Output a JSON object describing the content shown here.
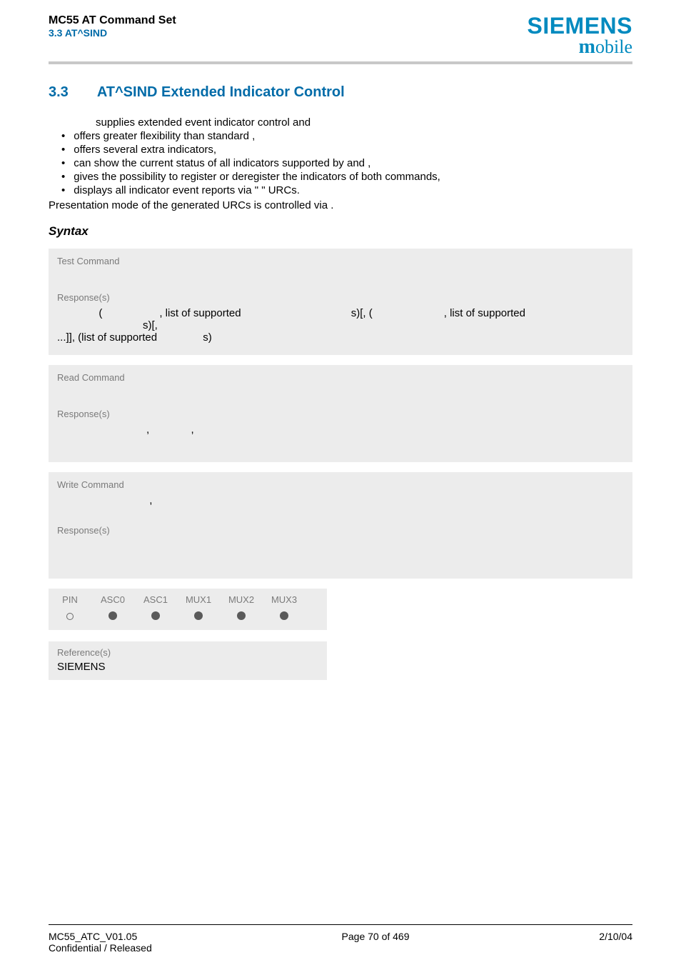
{
  "header": {
    "product": "MC55 AT Command Set",
    "section_ref": "3.3 AT^SIND",
    "brand_top": "SIEMENS",
    "brand_bottom_bold": "m",
    "brand_bottom_rest": "obile"
  },
  "section": {
    "number": "3.3",
    "title": "AT^SIND   Extended Indicator Control"
  },
  "intro": "supplies extended event indicator control and",
  "bullets": [
    "offers greater flexibility than standard               ,",
    "offers several extra indicators,",
    "can show the current status of all indicators supported by                  and               ,",
    "gives the possibility to register or deregister the indicators of both commands,",
    "displays all indicator event reports via \"            \" URCs."
  ],
  "presentation_line": "Presentation mode of the generated URCs is controlled via             .",
  "syntax_label": "Syntax",
  "panels": {
    "test": {
      "label": "Test Command",
      "body_spacer": " "
    },
    "test_resp": {
      "label": "Response(s)",
      "line1_parts": {
        "p1": "              (",
        "p2": ", list of supported ",
        "p3": "s)[, (",
        "p4": ", list of supported ",
        "p5": "s)[,"
      },
      "line2_parts": {
        "p1": "...]], (list of supported ",
        "p2": "s)"
      }
    },
    "read": {
      "label": "Read Command",
      "body_spacer": " "
    },
    "read_resp": {
      "label": "Response(s)",
      "line": "                              ,              ,"
    },
    "write": {
      "label": "Write Command",
      "line": "                               ,"
    },
    "write_resp": {
      "label": "Response(s)",
      "body_spacer": " "
    }
  },
  "dots": {
    "headers": [
      "PIN",
      "ASC0",
      "ASC1",
      "MUX1",
      "MUX2",
      "MUX3"
    ],
    "values": [
      "hollow",
      "filled",
      "filled",
      "filled",
      "filled",
      "filled"
    ]
  },
  "reference": {
    "label": "Reference(s)",
    "value": "SIEMENS"
  },
  "footer": {
    "left_line1": "MC55_ATC_V01.05",
    "left_line2": "Confidential / Released",
    "center": "Page 70 of 469",
    "right": "2/10/04"
  }
}
